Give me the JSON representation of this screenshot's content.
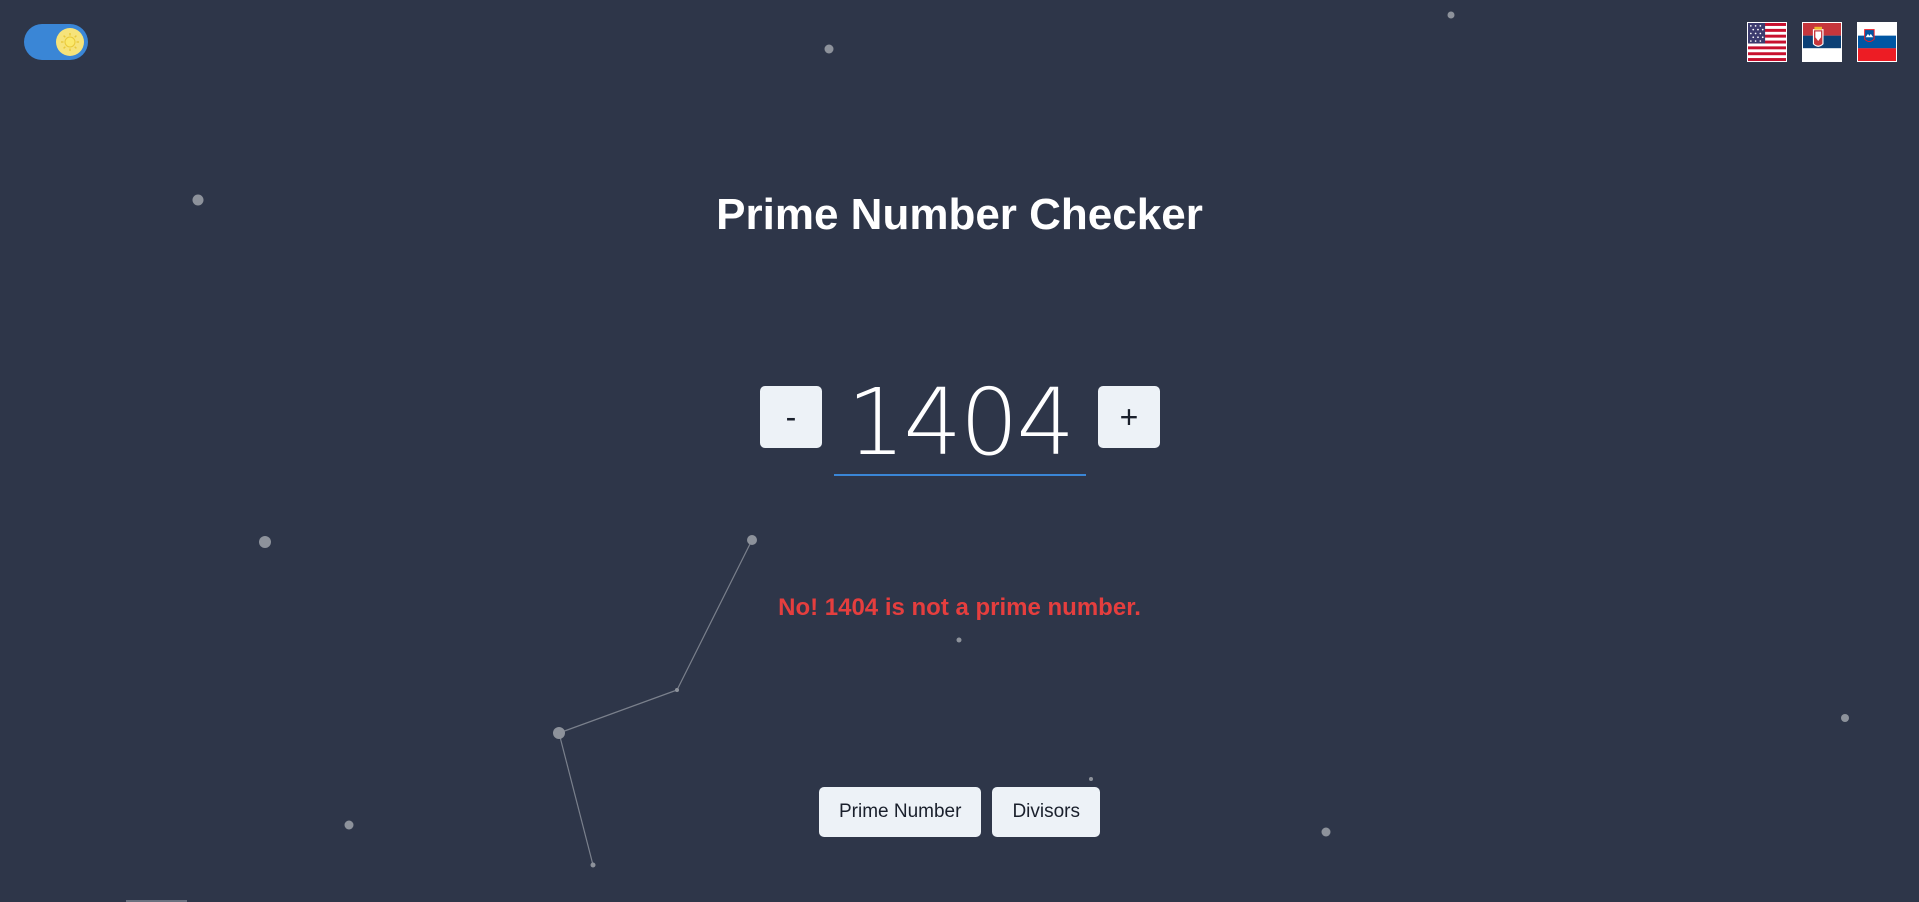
{
  "header": {
    "theme_toggle": {
      "state": "light",
      "icon": "sun-icon"
    },
    "languages": [
      {
        "name": "English",
        "icon": "us-flag-icon"
      },
      {
        "name": "Serbian",
        "icon": "serbia-flag-icon"
      },
      {
        "name": "Slovenian",
        "icon": "slovenia-flag-icon"
      }
    ]
  },
  "main": {
    "title": "Prime Number Checker",
    "counter": {
      "decrement_label": "-",
      "increment_label": "+",
      "value": "1404"
    },
    "result": "No! 1404 is not a prime number.",
    "modes": {
      "prime_label": "Prime Number",
      "divisors_label": "Divisors"
    }
  },
  "colors": {
    "background": "#2e3649",
    "accent": "#3a86d6",
    "error": "#e53e3e",
    "button": "#edf2f7"
  }
}
